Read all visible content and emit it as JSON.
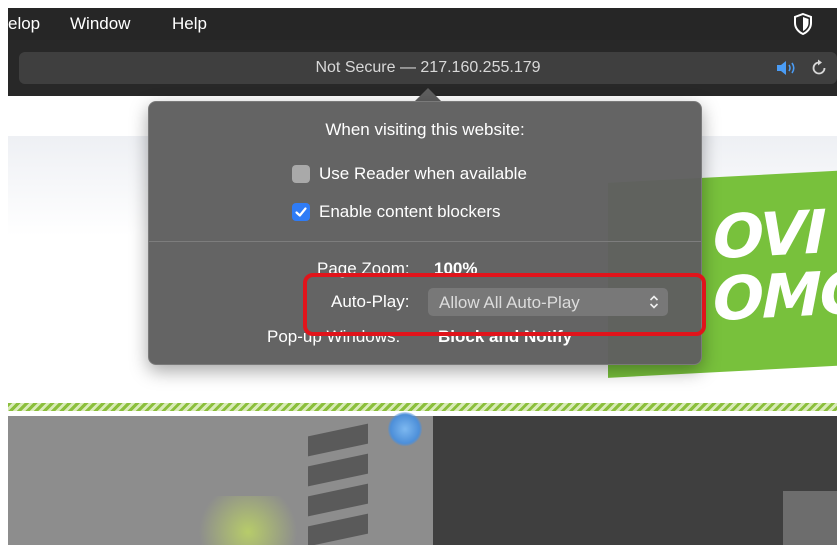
{
  "menubar": {
    "items": [
      "elop",
      "Window",
      "Help"
    ],
    "right_icon": "shield-icon"
  },
  "addressbar": {
    "text": "Not Secure — 217.160.255.179",
    "icons": [
      "speaker-icon",
      "reload-icon"
    ]
  },
  "webpage": {
    "banner_text_line1": "OVI",
    "banner_text_line2": "OMC",
    "colors": {
      "banner_green": "#78c13c"
    }
  },
  "popover": {
    "title": "When visiting this website:",
    "checkboxes": [
      {
        "label": "Use Reader when available",
        "checked": false
      },
      {
        "label": "Enable content blockers",
        "checked": true
      }
    ],
    "settings": {
      "page_zoom_label": "Page Zoom:",
      "page_zoom_value": "100%",
      "autoplay_label": "Auto-Play:",
      "autoplay_value": "Allow All Auto-Play",
      "popup_label": "Pop-up Windows:",
      "popup_value": "Block and Notify"
    }
  },
  "highlight": {
    "color": "#e0141b",
    "target": "Auto-Play"
  }
}
